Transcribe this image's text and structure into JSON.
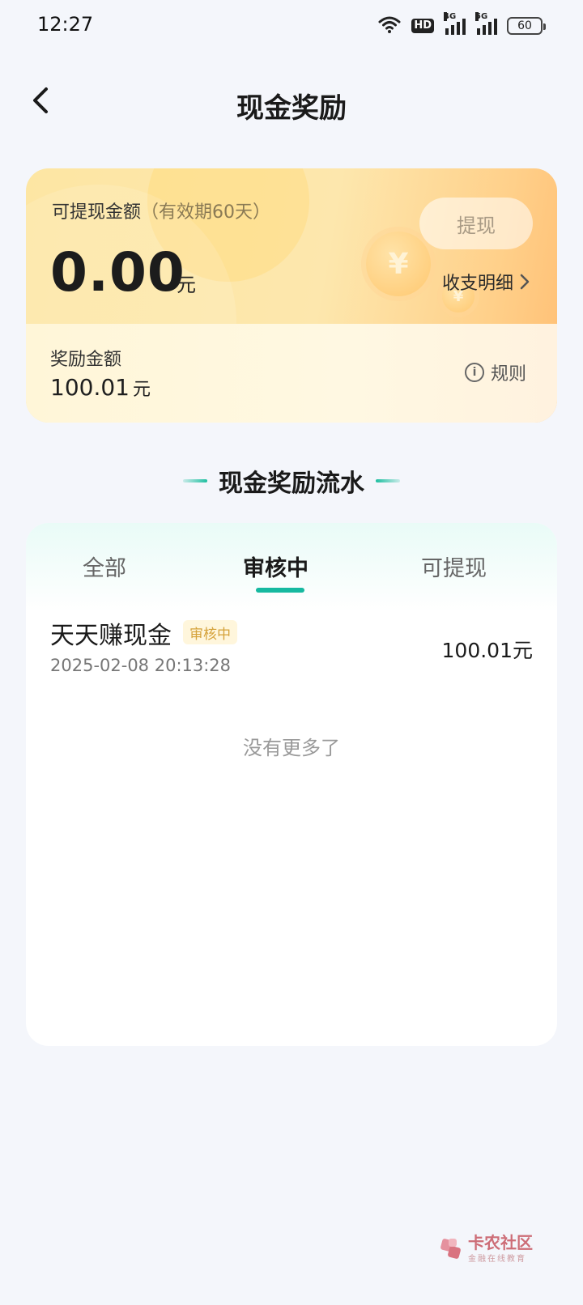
{
  "status_bar": {
    "time": "12:27",
    "hd_label": "HD",
    "network_1": "4G",
    "network_2": "5G",
    "battery": "60"
  },
  "header": {
    "back_icon": "chevron-left-icon",
    "title": "现金奖励"
  },
  "cash_card": {
    "withdrawable_label": "可提现金额",
    "validity_note": "（有效期60天）",
    "withdrawable_amount": "0.00",
    "unit": "元",
    "withdraw_button": "提现",
    "details_link": "收支明细",
    "reward_label": "奖励金额",
    "reward_amount": "100.01",
    "reward_unit": "元",
    "rules_link": "规则",
    "accent_color": "#ffbf74"
  },
  "section": {
    "title": "现金奖励流水"
  },
  "tabs": [
    {
      "label": "全部",
      "active": false
    },
    {
      "label": "审核中",
      "active": true
    },
    {
      "label": "可提现",
      "active": false
    }
  ],
  "records": [
    {
      "title": "天天赚现金",
      "status": "审核中",
      "time": "2025-02-08 20:13:28",
      "amount": "100.01元"
    }
  ],
  "list_footer": "没有更多了",
  "watermark": {
    "name": "卡农社区",
    "subtitle": "金融在线教育"
  },
  "colors": {
    "tab_indicator": "#16b9a0",
    "badge_text": "#d5a23a",
    "badge_bg": "#fff6dc"
  }
}
